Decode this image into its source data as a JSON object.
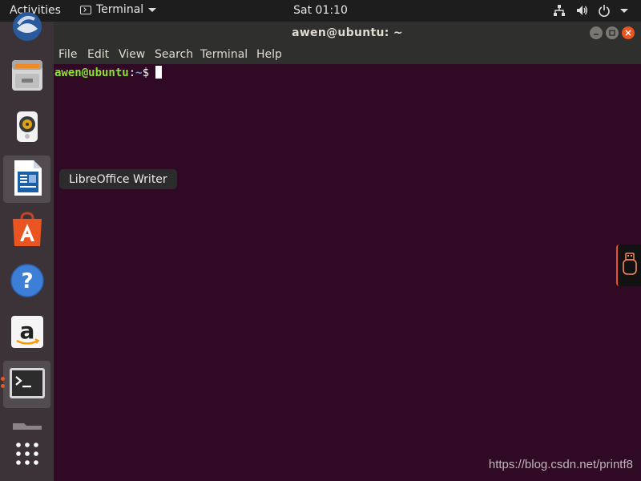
{
  "topbar": {
    "activities_label": "Activities",
    "app_menu_label": "Terminal",
    "clock": "Sat 01:10",
    "status_icons": [
      "network-icon",
      "volume-icon",
      "power-icon",
      "chevron-down-icon"
    ]
  },
  "dock": {
    "items": [
      {
        "name": "thunderbird",
        "icon": "thunderbird-icon"
      },
      {
        "name": "files",
        "icon": "files-icon"
      },
      {
        "name": "rhythmbox",
        "icon": "rhythmbox-icon"
      },
      {
        "name": "libreoffice-writer",
        "icon": "libreoffice-writer-icon",
        "hovered": true
      },
      {
        "name": "ubuntu-software",
        "icon": "ubuntu-software-icon"
      },
      {
        "name": "help",
        "icon": "help-icon"
      },
      {
        "name": "amazon",
        "icon": "amazon-icon"
      },
      {
        "name": "terminal",
        "icon": "terminal-icon",
        "running": true
      },
      {
        "name": "show-applications",
        "icon": "app-grid-icon"
      }
    ],
    "tooltip": "LibreOffice Writer"
  },
  "window": {
    "title": "awen@ubuntu: ~",
    "menu": [
      "File",
      "Edit",
      "View",
      "Search",
      "Terminal",
      "Help"
    ]
  },
  "terminal": {
    "user_host": "awen@ubuntu",
    "colon": ":",
    "path": "~",
    "dollar": "$"
  },
  "watermark": "https://blog.csdn.net/printf8",
  "colors": {
    "terminal_bg": "#300a24",
    "topbar_bg": "#1d1d1d",
    "dock_bg": "#3b3338",
    "accent": "#e95420",
    "prompt_user": "#8ae234",
    "prompt_path": "#729fcf"
  }
}
